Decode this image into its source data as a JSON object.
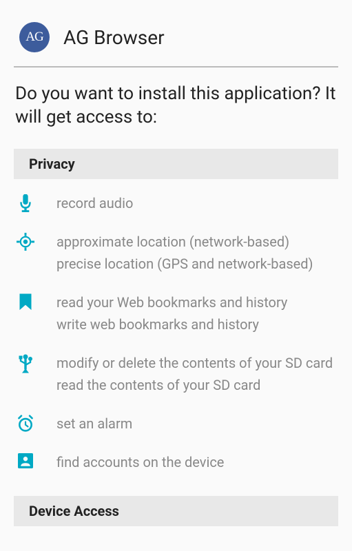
{
  "app": {
    "icon_text": "AG",
    "name": "AG Browser"
  },
  "install_question": "Do you want to install this application? It will get access to:",
  "sections": {
    "privacy": {
      "title": "Privacy",
      "items": [
        {
          "icon": "microphone",
          "lines": [
            "record audio"
          ]
        },
        {
          "icon": "location",
          "lines": [
            "approximate location (network-based)",
            "precise location (GPS and network-based)"
          ]
        },
        {
          "icon": "bookmark",
          "lines": [
            "read your Web bookmarks and history",
            "write web bookmarks and history"
          ]
        },
        {
          "icon": "usb",
          "lines": [
            "modify or delete the contents of your SD card",
            "read the contents of your SD card"
          ]
        },
        {
          "icon": "alarm",
          "lines": [
            "set an alarm"
          ]
        },
        {
          "icon": "account",
          "lines": [
            "find accounts on the device"
          ]
        }
      ]
    },
    "device_access": {
      "title": "Device Access"
    }
  }
}
